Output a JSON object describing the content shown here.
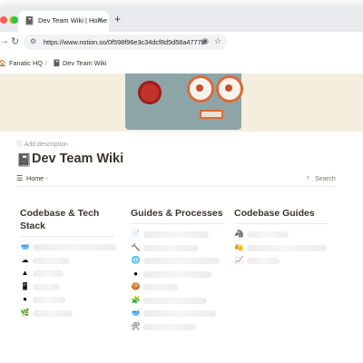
{
  "browser": {
    "tab_title": "Dev Team Wiki | Home",
    "url": "https://www.notion.so/0f598f96e3c34dcf8d5d58a4777b..."
  },
  "breadcrumbs": [
    "Fanatic HQ",
    "/",
    "Dev Team Wiki"
  ],
  "page": {
    "add_description": "Add description",
    "title": "Dev Team Wiki"
  },
  "view": {
    "label": "Home",
    "search": "Search"
  },
  "columns": [
    {
      "title": "Codebase & Tech Stack",
      "items": [
        {
          "icon": "bowl-icon",
          "glyph": "🥣"
        },
        {
          "icon": "cloud-icon",
          "glyph": "☁"
        },
        {
          "icon": "warning-icon",
          "glyph": "▲"
        },
        {
          "icon": "phone-icon",
          "glyph": "📱"
        },
        {
          "icon": "github-icon",
          "glyph": "●"
        },
        {
          "icon": "leaf-icon",
          "glyph": "🌿"
        }
      ]
    },
    {
      "title": "Guides & Processes",
      "items": [
        {
          "icon": "page-icon",
          "glyph": "📄"
        },
        {
          "icon": "hammer-icon",
          "glyph": "🔨"
        },
        {
          "icon": "globe-icon",
          "glyph": "🌐"
        },
        {
          "icon": "github-icon",
          "glyph": "●"
        },
        {
          "icon": "cookie-icon",
          "glyph": "🍪"
        },
        {
          "icon": "puzzle-icon",
          "glyph": "🧩"
        },
        {
          "icon": "bowl-icon",
          "glyph": "🥣"
        },
        {
          "icon": "tools-icon",
          "glyph": "🛠"
        }
      ]
    },
    {
      "title": "Codebase Guides",
      "items": [
        {
          "icon": "zebra-icon",
          "glyph": "🦓"
        },
        {
          "icon": "lemon-icon",
          "glyph": "🍋"
        },
        {
          "icon": "chart-icon",
          "glyph": "📈"
        }
      ]
    }
  ]
}
